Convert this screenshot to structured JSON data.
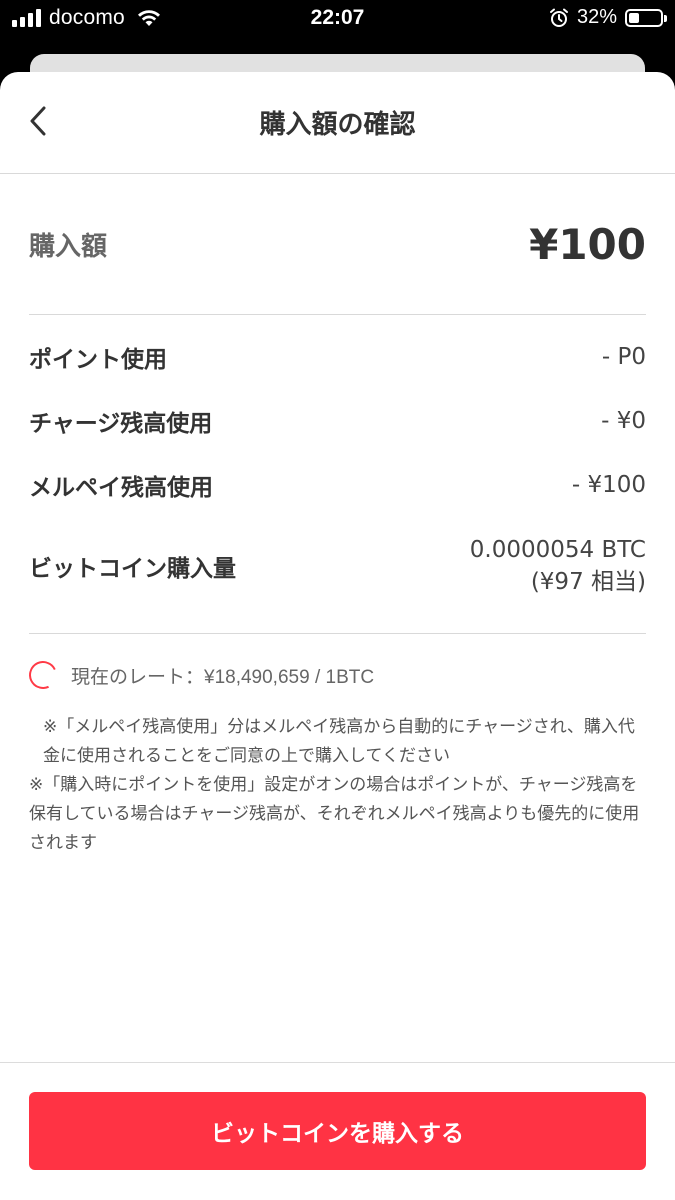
{
  "status_bar": {
    "carrier": "docomo",
    "time": "22:07",
    "battery": "32%",
    "battery_fraction": 0.32,
    "icons": [
      "signal-icon",
      "wifi-icon",
      "alarm-icon",
      "battery-icon"
    ]
  },
  "header": {
    "title": "購入額の確認",
    "back_icon": "chevron-left-icon"
  },
  "purchase": {
    "label": "購入額",
    "value": "¥100"
  },
  "breakdown": [
    {
      "label": "ポイント使用",
      "value": "- P0"
    },
    {
      "label": "チャージ残高使用",
      "value": "- ¥0"
    },
    {
      "label": "メルペイ残高使用",
      "value": "- ¥100"
    }
  ],
  "btc_amount": {
    "label": "ビットコイン購入量",
    "value_line1": "0.0000054 BTC",
    "value_line2": "(¥97 相当)"
  },
  "rate": {
    "text": "現在のレート：¥18,490,659 / 1BTC"
  },
  "notes": [
    "※「メルペイ残高使用」分はメルペイ残高から自動的にチャージされ、購入代金に使用されることをご同意の上で購入してください",
    "※「購入時にポイントを使用」設定がオンの場合はポイントが、チャージ残高を保有している場合はチャージ残高が、それぞれメルペイ残高よりも優先的に使用されます"
  ],
  "cta": {
    "label": "ビットコインを購入する"
  },
  "colors": {
    "accent": "#ff3344",
    "text_primary": "#333333",
    "text_secondary": "#666666"
  }
}
